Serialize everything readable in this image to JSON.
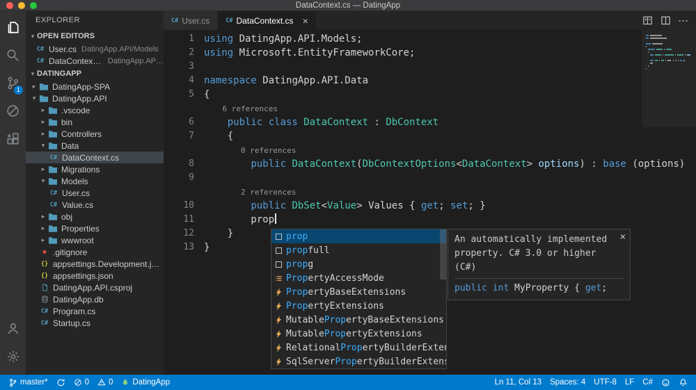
{
  "colors": {
    "accent": "#007acc",
    "status_bar_background": "#007acc",
    "editor_background": "#1e1e1e",
    "sidebar_background": "#252526",
    "activity_bar_background": "#333333",
    "title_bar_background": "#3b3b3d",
    "keyword": "#569cd6",
    "type_name": "#4ec9b0",
    "parameter": "#9cdcfe",
    "plain_text": "#d4d4d4",
    "match_highlight": "#3caeff",
    "list_selection": "#094771",
    "folder_icon": "#519aba",
    "csharp_icon": "#519aba",
    "json_icon": "#cbcb41",
    "git_icon": "#e44d42",
    "symbol_icon": "#e8ab53",
    "task_icon": "#89d185"
  },
  "window": {
    "title": "DataContext.cs — DatingApp"
  },
  "activity_bar": {
    "items": [
      {
        "id": "explorer",
        "icon": "files-icon",
        "active": true
      },
      {
        "id": "search",
        "icon": "search-icon"
      },
      {
        "id": "source-control",
        "icon": "source-control-icon",
        "badge": "1"
      },
      {
        "id": "debug",
        "icon": "debug-icon"
      },
      {
        "id": "extensions",
        "icon": "extensions-icon"
      }
    ],
    "bottom_items": [
      {
        "id": "account",
        "icon": "account-icon"
      },
      {
        "id": "settings",
        "icon": "gear-icon"
      }
    ]
  },
  "sidebar": {
    "title": "EXPLORER",
    "open_editors": {
      "header": "OPEN EDITORS",
      "items": [
        {
          "label": "User.cs",
          "detail": "DatingApp.API/Models",
          "icon": "csharp-icon"
        },
        {
          "label": "DataContext.cs",
          "detail": "DatingApp.API/...",
          "icon": "csharp-icon"
        }
      ]
    },
    "tree": {
      "header": "DATINGAPP",
      "items": [
        {
          "label": "DatingApp-SPA",
          "type": "folder",
          "level": 0,
          "expanded": false
        },
        {
          "label": "DatingApp.API",
          "type": "folder",
          "level": 0,
          "expanded": true
        },
        {
          "label": ".vscode",
          "type": "folder",
          "level": 1,
          "expanded": false
        },
        {
          "label": "bin",
          "type": "folder",
          "level": 1,
          "expanded": false
        },
        {
          "label": "Controllers",
          "type": "folder",
          "level": 1,
          "expanded": false
        },
        {
          "label": "Data",
          "type": "folder",
          "level": 1,
          "expanded": true
        },
        {
          "label": "DataContext.cs",
          "type": "file",
          "icon": "csharp-icon",
          "level": 2,
          "selected": true
        },
        {
          "label": "Migrations",
          "type": "folder",
          "level": 1,
          "expanded": false
        },
        {
          "label": "Models",
          "type": "folder",
          "level": 1,
          "expanded": true
        },
        {
          "label": "User.cs",
          "type": "file",
          "icon": "csharp-icon",
          "level": 2
        },
        {
          "label": "Value.cs",
          "type": "file",
          "icon": "csharp-icon",
          "level": 2
        },
        {
          "label": "obj",
          "type": "folder",
          "level": 1,
          "expanded": false
        },
        {
          "label": "Properties",
          "type": "folder",
          "level": 1,
          "expanded": false
        },
        {
          "label": "wwwroot",
          "type": "folder",
          "level": 1,
          "expanded": false
        },
        {
          "label": ".gitignore",
          "type": "file",
          "icon": "git-file-icon",
          "level": 1
        },
        {
          "label": "appsettings.Development.json",
          "type": "file",
          "icon": "json-icon",
          "level": 1
        },
        {
          "label": "appsettings.json",
          "type": "file",
          "icon": "json-icon",
          "level": 1
        },
        {
          "label": "DatingApp.API.csproj",
          "type": "file",
          "icon": "project-file-icon",
          "level": 1
        },
        {
          "label": "DatingApp.db",
          "type": "file",
          "icon": "database-file-icon",
          "level": 1
        },
        {
          "label": "Program.cs",
          "type": "file",
          "icon": "csharp-icon",
          "level": 1
        },
        {
          "label": "Startup.cs",
          "type": "file",
          "icon": "csharp-icon",
          "level": 1
        }
      ]
    }
  },
  "editor": {
    "tabs": [
      {
        "label": "User.cs",
        "icon": "csharp-icon",
        "active": false
      },
      {
        "label": "DataContext.cs",
        "icon": "csharp-icon",
        "active": true,
        "close_label": "×"
      }
    ],
    "actions": [
      {
        "id": "open-changes",
        "icon": "open-changes-icon"
      },
      {
        "id": "split-editor",
        "icon": "split-editor-icon"
      },
      {
        "id": "more-actions",
        "icon": "more-actions-icon"
      }
    ],
    "lines": [
      {
        "n": 1,
        "segs": [
          [
            "using ",
            "kw"
          ],
          [
            "DatingApp.API.Models;",
            "plain"
          ]
        ]
      },
      {
        "n": 2,
        "segs": [
          [
            "using ",
            "kw"
          ],
          [
            "Microsoft.EntityFrameworkCore;",
            "plain"
          ]
        ]
      },
      {
        "n": 3,
        "segs": []
      },
      {
        "n": 4,
        "segs": [
          [
            "namespace ",
            "kw"
          ],
          [
            "DatingApp.API.Data",
            "plain"
          ]
        ]
      },
      {
        "n": 5,
        "segs": [
          [
            "{",
            "plain"
          ]
        ]
      },
      {
        "codelens": "6 references",
        "indent_ch": 4
      },
      {
        "n": 6,
        "segs": [
          [
            "    ",
            "plain"
          ],
          [
            "public class ",
            "kw"
          ],
          [
            "DataContext",
            "type"
          ],
          [
            " : ",
            "plain"
          ],
          [
            "DbContext",
            "type"
          ]
        ]
      },
      {
        "n": 7,
        "segs": [
          [
            "    {",
            "plain"
          ]
        ]
      },
      {
        "codelens": "0 references",
        "indent_ch": 8
      },
      {
        "n": 8,
        "segs": [
          [
            "        ",
            "plain"
          ],
          [
            "public ",
            "kw"
          ],
          [
            "DataContext",
            "type"
          ],
          [
            "(",
            "plain"
          ],
          [
            "DbContextOptions",
            "type"
          ],
          [
            "<",
            "plain"
          ],
          [
            "DataContext",
            "type"
          ],
          [
            "> ",
            "plain"
          ],
          [
            "options",
            "param"
          ],
          [
            ") : ",
            "plain"
          ],
          [
            "base ",
            "kw"
          ],
          [
            "(options)",
            "plain"
          ]
        ]
      },
      {
        "n": 9,
        "segs": []
      },
      {
        "codelens": "2 references",
        "indent_ch": 8
      },
      {
        "n": 10,
        "segs": [
          [
            "        ",
            "plain"
          ],
          [
            "public ",
            "kw"
          ],
          [
            "DbSet",
            "type"
          ],
          [
            "<",
            "plain"
          ],
          [
            "Value",
            "type"
          ],
          [
            "> ",
            "plain"
          ],
          [
            "Values",
            "plain"
          ],
          [
            " { ",
            "plain"
          ],
          [
            "get",
            "kw"
          ],
          [
            "; ",
            "plain"
          ],
          [
            "set",
            "kw"
          ],
          [
            "; }",
            "plain"
          ]
        ]
      },
      {
        "n": 11,
        "segs": [
          [
            "        prop",
            "plain"
          ]
        ],
        "cursor": true
      },
      {
        "n": 12,
        "segs": [
          [
            "    }",
            "plain"
          ]
        ]
      },
      {
        "n": 13,
        "segs": [
          [
            "}",
            "plain"
          ]
        ]
      }
    ]
  },
  "suggest": {
    "items": [
      {
        "pre": "",
        "match": "prop",
        "post": "",
        "icon": "snippet-icon",
        "selected": true
      },
      {
        "pre": "",
        "match": "prop",
        "post": "full",
        "icon": "snippet-icon"
      },
      {
        "pre": "",
        "match": "prop",
        "post": "g",
        "icon": "snippet-icon"
      },
      {
        "pre": "",
        "match": "Prop",
        "post": "ertyAccessMode",
        "icon": "enum-icon"
      },
      {
        "pre": "",
        "match": "Prop",
        "post": "ertyBaseExtensions",
        "icon": "class-icon"
      },
      {
        "pre": "",
        "match": "Prop",
        "post": "ertyExtensions",
        "icon": "class-icon"
      },
      {
        "pre": "Mutable",
        "match": "Prop",
        "post": "ertyBaseExtensions",
        "icon": "class-icon"
      },
      {
        "pre": "Mutable",
        "match": "Prop",
        "post": "ertyExtensions",
        "icon": "class-icon"
      },
      {
        "pre": "Relational",
        "match": "Prop",
        "post": "ertyBuilderExtensions",
        "icon": "class-icon"
      },
      {
        "pre": "SqlServer",
        "match": "Prop",
        "post": "ertyBuilderExtensions",
        "icon": "class-icon"
      }
    ]
  },
  "suggest_doc": {
    "text": "An automatically implemented property. C# 3.0 or higher (C#)",
    "code": [
      [
        "public int ",
        "kw"
      ],
      [
        "MyProperty",
        "plain"
      ],
      [
        " { ",
        "plain"
      ],
      [
        "get",
        "kw"
      ],
      [
        ";",
        "plain"
      ]
    ],
    "close_label": "×"
  },
  "status_bar": {
    "left": [
      {
        "id": "branch",
        "icon": "branch-icon",
        "label": "master*"
      },
      {
        "id": "sync",
        "icon": "sync-icon",
        "label": ""
      },
      {
        "id": "errors",
        "icon": "error-icon",
        "label": "0"
      },
      {
        "id": "warnings",
        "icon": "warning-icon",
        "label": "0"
      },
      {
        "id": "task",
        "icon": "flame-icon",
        "label": "DatingApp"
      }
    ],
    "right": [
      {
        "id": "cursor-position",
        "label": "Ln 11, Col 13"
      },
      {
        "id": "indentation",
        "label": "Spaces: 4"
      },
      {
        "id": "encoding",
        "label": "UTF-8"
      },
      {
        "id": "eol",
        "label": "LF"
      },
      {
        "id": "language-mode",
        "label": "C#"
      },
      {
        "id": "feedback",
        "icon": "smiley-icon",
        "label": ""
      },
      {
        "id": "notifications",
        "icon": "bell-icon",
        "label": ""
      }
    ]
  }
}
